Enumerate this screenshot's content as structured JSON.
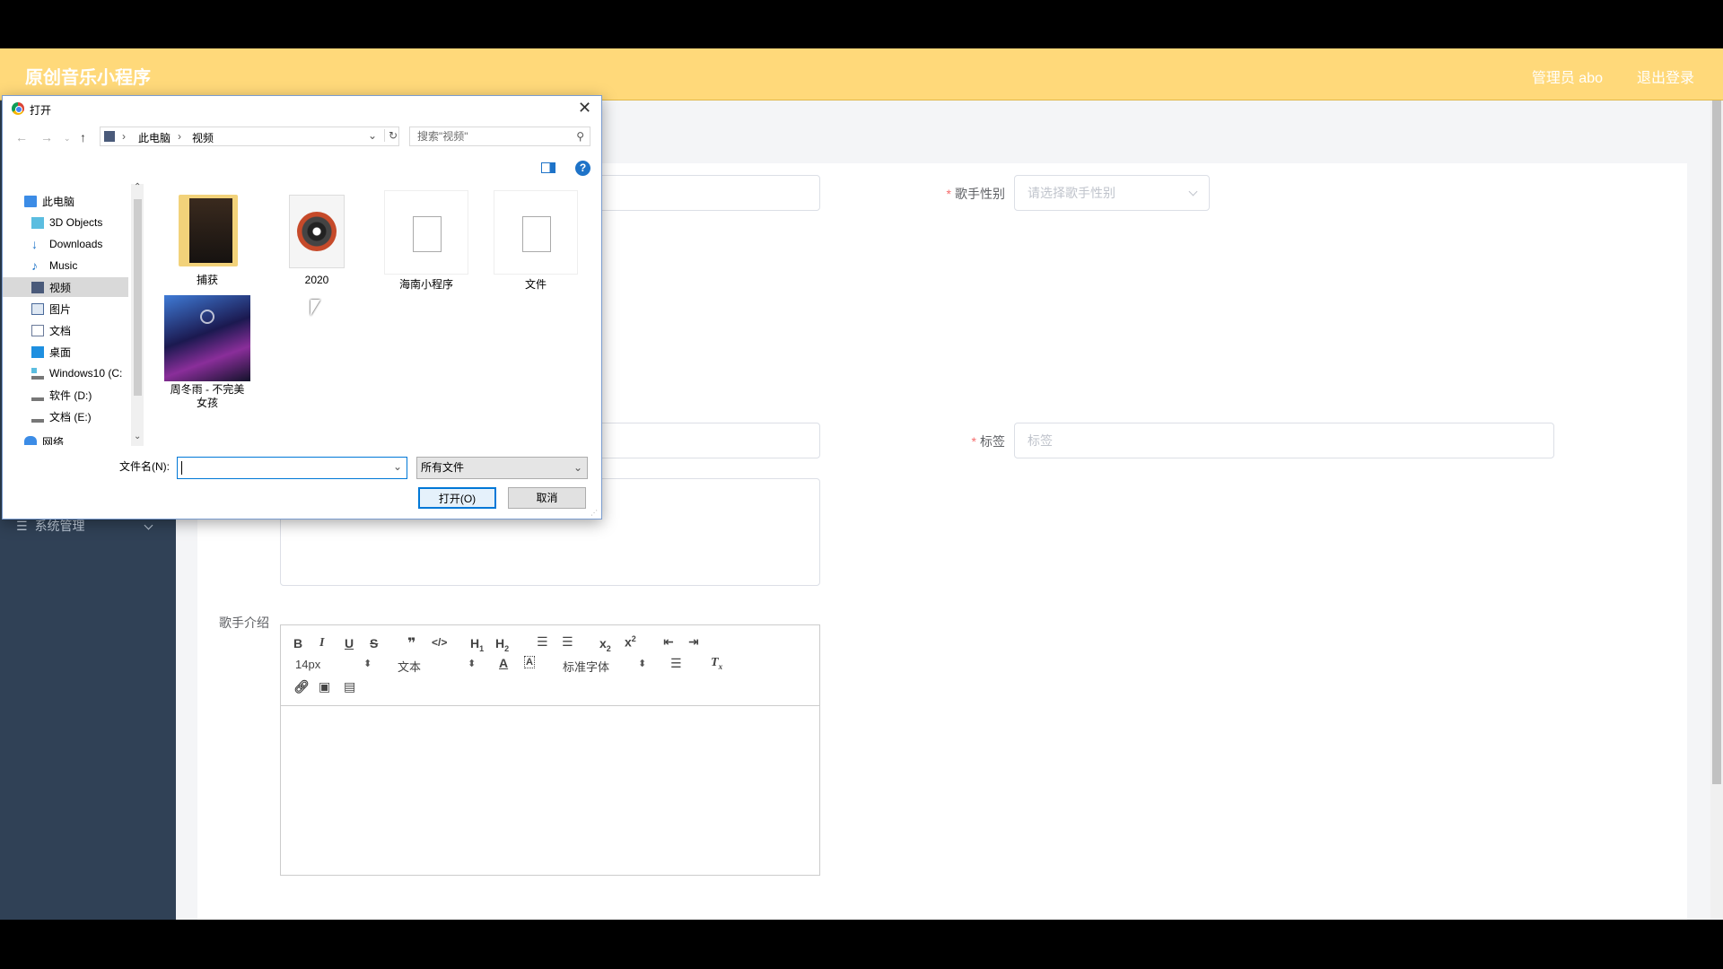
{
  "app": {
    "brand": "原创音乐小程序",
    "user": "管理员 abo",
    "logout": "退出登录",
    "sidebar_menu": "系统管理"
  },
  "form": {
    "gender_label": "歌手性别",
    "gender_placeholder": "请选择歌手性别",
    "tag_label": "标签",
    "tag_placeholder": "标签",
    "intro_label": "歌手介绍"
  },
  "editor": {
    "font_size": "14px",
    "text_type": "文本",
    "font_family": "标准字体"
  },
  "dialog": {
    "title": "打开",
    "breadcrumb": [
      "此电脑",
      "视频"
    ],
    "search_placeholder": "搜索\"视频\"",
    "tree": [
      {
        "label": "此电脑",
        "icon": "computer-icon"
      },
      {
        "label": "3D Objects",
        "icon": "cube-icon"
      },
      {
        "label": "Downloads",
        "icon": "download-icon"
      },
      {
        "label": "Music",
        "icon": "music-icon"
      },
      {
        "label": "视频",
        "icon": "video-icon",
        "selected": true
      },
      {
        "label": "图片",
        "icon": "picture-icon"
      },
      {
        "label": "文档",
        "icon": "document-icon"
      },
      {
        "label": "桌面",
        "icon": "desktop-icon"
      },
      {
        "label": "Windows10 (C:",
        "icon": "drive-icon"
      },
      {
        "label": "软件 (D:)",
        "icon": "drive-icon"
      },
      {
        "label": "文档 (E:)",
        "icon": "drive-icon"
      },
      {
        "label": "网络",
        "icon": "network-icon"
      }
    ],
    "files": [
      {
        "name": "捕获",
        "type": "folder"
      },
      {
        "name": "2020",
        "type": "media"
      },
      {
        "name": "海南小程序",
        "type": "file"
      },
      {
        "name": "文件",
        "type": "file"
      },
      {
        "name": "周冬雨 - 不完美女孩",
        "type": "video"
      }
    ],
    "filename_label": "文件名(N):",
    "filename_value": "",
    "filetype": "所有文件",
    "open_button": "打开(O)",
    "cancel_button": "取消"
  }
}
